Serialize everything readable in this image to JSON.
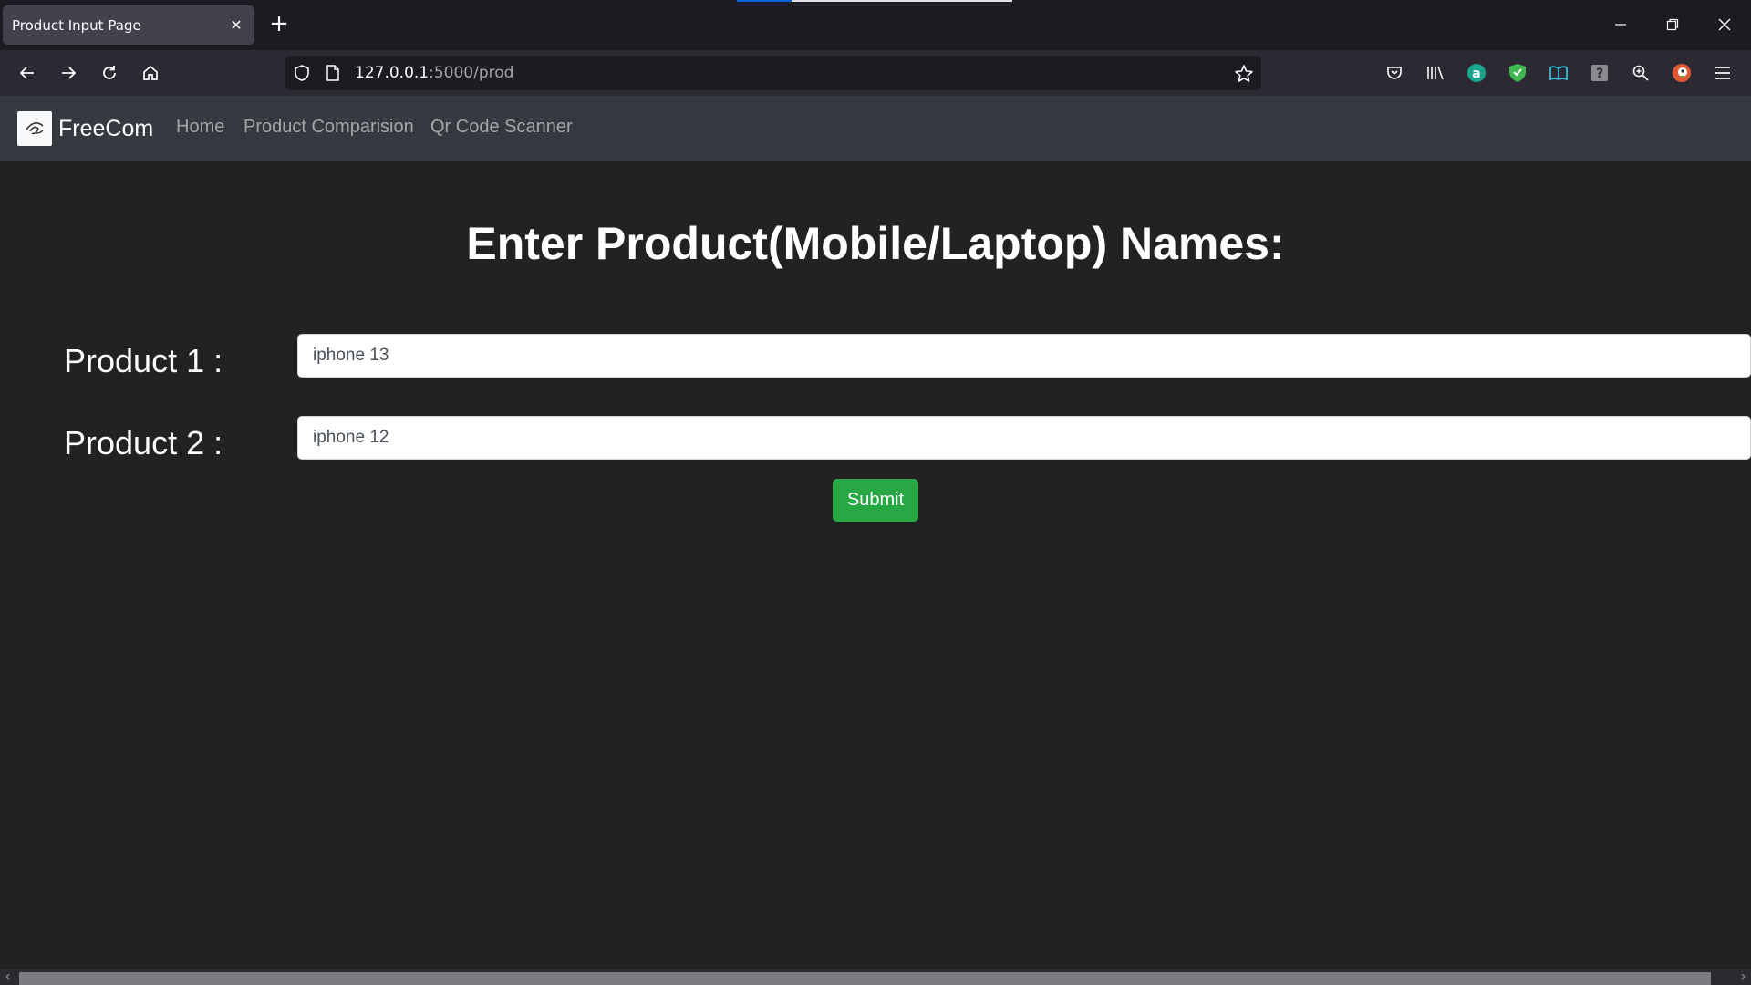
{
  "browser": {
    "tab_title": "Product Input Page",
    "tab_close_glyph": "✕",
    "new_tab_glyph": "+",
    "url_host": "127.0.0.1",
    "url_path": ":5000/prod",
    "icons": [
      "back-icon",
      "forward-icon",
      "reload-icon",
      "home-icon",
      "shield-icon",
      "page-icon",
      "bookmark-star-icon",
      "pocket-icon",
      "library-icon",
      "amazon-extension-icon",
      "adblock-shield-icon",
      "reader-icon",
      "help-extension-icon",
      "zoom-icon",
      "duckduckgo-icon",
      "menu-icon",
      "minimize-icon",
      "restore-icon",
      "close-window-icon"
    ]
  },
  "site": {
    "brand": "FreeCom",
    "nav": {
      "home": "Home",
      "compare": "Product Comparision",
      "qr": "Qr Code Scanner"
    },
    "heading": "Enter Product(Mobile/Laptop) Names:",
    "product1": {
      "label": "Product 1 :",
      "value": "iphone 13"
    },
    "product2": {
      "label": "Product 2 :",
      "value": "iphone 12"
    },
    "submit": "Submit"
  },
  "colors": {
    "page_bg": "#222222",
    "navbar_bg": "#343a40",
    "submit_bg": "#28a745",
    "chrome_bg": "#2b2a33",
    "tabstrip_bg": "#1c1b22"
  }
}
